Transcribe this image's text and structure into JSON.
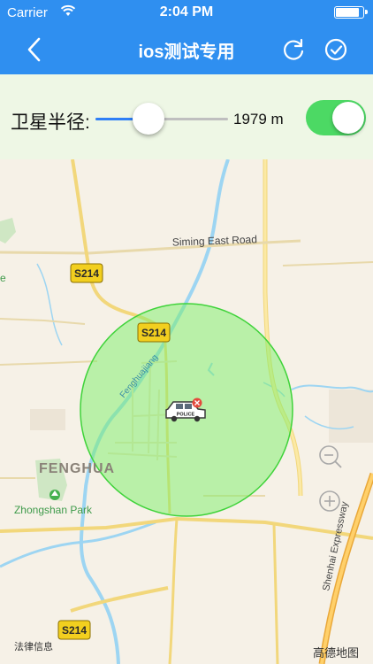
{
  "status": {
    "carrier": "Carrier",
    "time": "2:04 PM"
  },
  "nav": {
    "title": "ios测试专用",
    "back_icon": "chevron-left-icon",
    "refresh_icon": "refresh-icon",
    "confirm_icon": "check-circle-icon"
  },
  "control": {
    "label": "卫星半径:",
    "slider_value_text": "1979 m",
    "slider_fraction": 0.4,
    "toggle_on": true
  },
  "map": {
    "road_labels": {
      "siming": "Siming East Road",
      "s214_top": "S214",
      "s214_mid": "S214",
      "s214_bottom": "S214",
      "expressway": "Shenhai Expressway",
      "river": "Fenghuajiang"
    },
    "place_labels": {
      "town": "FENGHUA",
      "park": "Zhongshan Park",
      "edge": "e"
    },
    "police_label": "POLICE",
    "legal": "法律信息",
    "brand": "高德地图"
  },
  "colors": {
    "accent": "#2f8ff0",
    "toggle_on": "#4cd964",
    "circle_fill": "#7cf06a",
    "circle_stroke": "#3fd33a"
  }
}
